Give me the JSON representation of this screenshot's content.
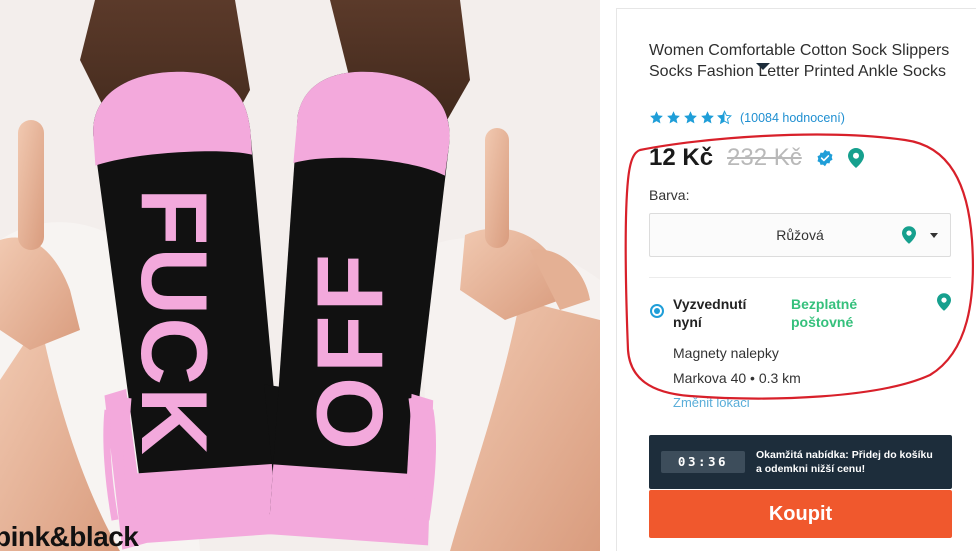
{
  "product_image": {
    "sock_left_text": "FUCK",
    "sock_right_text": "OFF",
    "caption": "pink&black"
  },
  "product": {
    "title": "Women Comfortable Cotton Sock Slippers Socks Fashion Letter Printed Ankle Socks",
    "rating": 4.5,
    "rating_max": 5,
    "rating_count_label": "(10084 hodnocení)",
    "price": "12 Kč",
    "original_price": "232 Kč"
  },
  "color_option": {
    "label": "Barva:",
    "selected": "Růžová"
  },
  "delivery": {
    "option_label": "Vyzvednutí nyní",
    "shipping_label": "Bezplatné poštovné",
    "store_name": "Magnety nalepky",
    "store_address": "Markova 40 • 0.3 km",
    "change_location_label": "Změnit lokaci"
  },
  "offer": {
    "timer": "03:36",
    "text": "Okamžitá nabídka: Přidej do košíku a odemkni nižší cenu!"
  },
  "buy_button_label": "Koupit",
  "colors": {
    "accent_orange": "#f0582d",
    "star_blue": "#1f9ed8",
    "free_shipping_green": "#35c07c",
    "pin_teal": "#16a08e",
    "offer_bar": "#1d2d3b",
    "annotation_red": "#d8202a"
  },
  "icons": {
    "verified": "verified-badge-icon",
    "location": "location-pin-icon",
    "dropdown": "chevron-down-icon"
  }
}
